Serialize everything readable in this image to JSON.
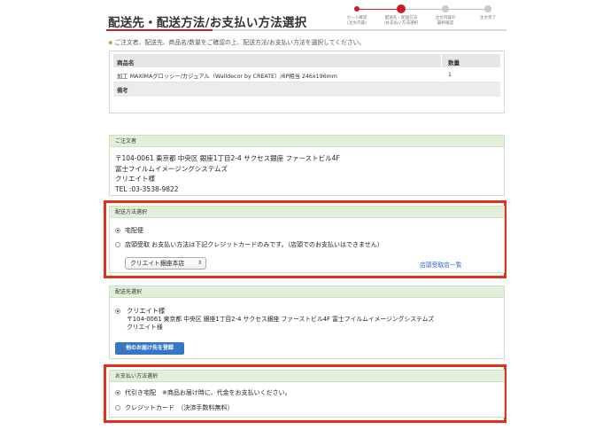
{
  "page": {
    "title": "配送先・配送方法/お支払い方法選択",
    "notice_mark": "◆",
    "notice": "ご注文者、配送先、商品名/数量をご確認の上、配送方法/お支払い方法を選択してください。"
  },
  "steps": [
    {
      "label": "カート確認\n(注文内容)",
      "state": "done"
    },
    {
      "label": "配送先・配送方法\n/お支払い方法選択",
      "state": "current"
    },
    {
      "label": "注文内容の\n最終確認",
      "state": "todo"
    },
    {
      "label": "注文完了",
      "state": "todo"
    }
  ],
  "product_table": {
    "headers": {
      "name": "商品名",
      "qty": "数量"
    },
    "rows": [
      {
        "name": "加工 MAXIMAグロッシー/カジュアル（Walldecor by CREATE）/6P相当 246x196mm",
        "qty": "1"
      }
    ],
    "memo_label": "備考"
  },
  "orderer": {
    "heading": "ご注文者",
    "lines": [
      "〒104-0061 東京都 中央区 銀座1丁目2-4 サクセス銀座 ファーストビル4F",
      "富士フイルムイメージングシステムズ",
      "クリエイト様",
      "TEL :03-3538-9822"
    ]
  },
  "delivery_method": {
    "heading": "配送方法選択",
    "options": [
      {
        "label": "宅配便",
        "selected": true
      },
      {
        "label": "店頭受取 お支払い方法は下記クレジットカードのみです。（店頭でのお支払いはできません）",
        "selected": false
      }
    ],
    "store_select": "クリエイト銀座本店",
    "store_list_link": "店頭受取店一覧"
  },
  "destination": {
    "heading": "配送先選択",
    "name": "クリエイト様",
    "address": "〒104-0061 東京都 中央区 銀座1丁目2-4 サクセス銀座 ファーストビル4F 富士フイルムイメージングシステムズ",
    "recipient": "クリエイト様",
    "add_button": "他のお届け先を登録"
  },
  "payment": {
    "heading": "お支払い方法選択",
    "options": [
      {
        "label": "代引き宅配　※商品お届け時に、代金をお支払いください。",
        "selected": true
      },
      {
        "label": "クレジットカード　（決済手数料無料）",
        "selected": false
      }
    ]
  },
  "colors": {
    "accent": "#c81e2c",
    "highlight_frame": "#e0321c",
    "box_header": "#e2efd9",
    "link": "#2b66c9",
    "button": "#3677c4"
  }
}
